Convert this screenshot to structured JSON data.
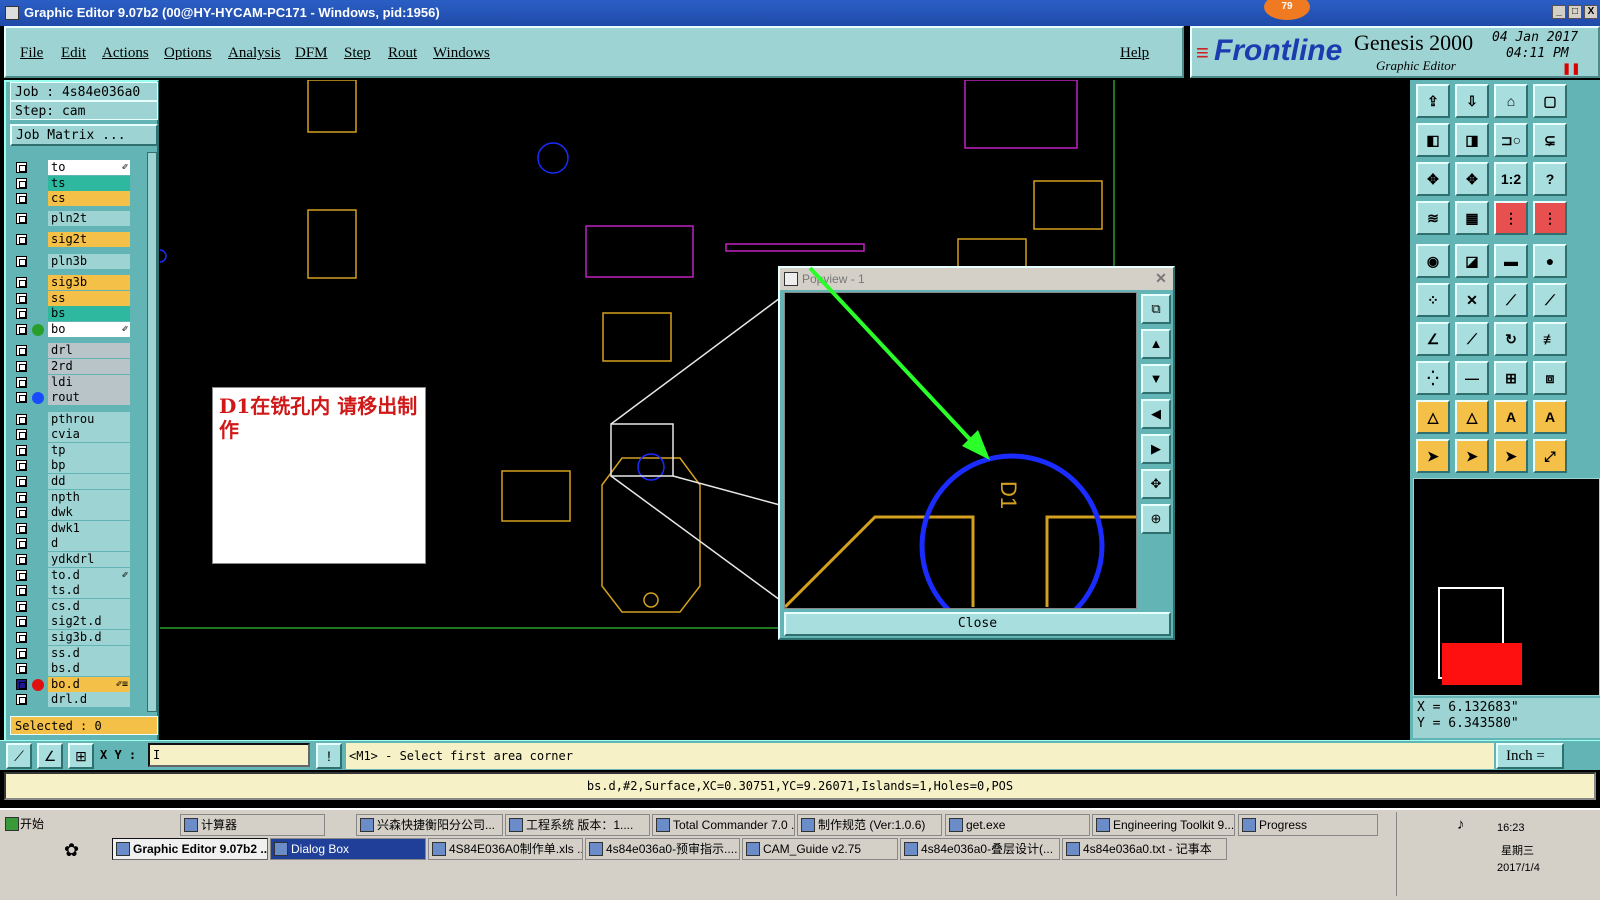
{
  "window": {
    "title": "Graphic Editor 9.07b2 (00@HY-HYCAM-PC171 - Windows, pid:1956)",
    "badge": "79",
    "min": "_",
    "max": "□",
    "close": "X"
  },
  "menu": {
    "file": "File",
    "edit": "Edit",
    "actions": "Actions",
    "options": "Options",
    "analysis": "Analysis",
    "dfm": "DFM",
    "step": "Step",
    "rout": "Rout",
    "windows": "Windows",
    "help": "Help"
  },
  "brand": {
    "logo": "Frontline",
    "product": "Genesis 2000",
    "subtitle": "Graphic Editor",
    "date": "04 Jan 2017",
    "time": "04:11 PM"
  },
  "job": {
    "job_line": "Job : 4s84e036a0",
    "step_line": "Step: cam",
    "matrix_button": "Job Matrix ...",
    "selected": "Selected : 0"
  },
  "layers": [
    {
      "name": "to",
      "color": "#ffffff",
      "mark": "✐"
    },
    {
      "name": "ts",
      "color": "#2fb8a0"
    },
    {
      "name": "cs",
      "color": "#f5c048"
    },
    {
      "name": "pln2t",
      "color": "#9ed3d3"
    },
    {
      "name": "sig2t",
      "color": "#f5c048"
    },
    {
      "name": "pln3b",
      "color": "#9ed3d3"
    },
    {
      "name": "sig3b",
      "color": "#f5c048"
    },
    {
      "name": "ss",
      "color": "#f5c048"
    },
    {
      "name": "bs",
      "color": "#2fb8a0"
    },
    {
      "name": "bo",
      "color": "#ffffff",
      "mark": "✐",
      "dot": "#2a9e2a"
    },
    {
      "name": "drl",
      "color": "#b8c4c8"
    },
    {
      "name": "2rd",
      "color": "#b8c4c8"
    },
    {
      "name": "ldi",
      "color": "#b8c4c8"
    },
    {
      "name": "rout",
      "color": "#b8c4c8",
      "dot": "#1a4cff"
    },
    {
      "name": "pthrou",
      "color": "#9ed3d3"
    },
    {
      "name": "cvia",
      "color": "#9ed3d3"
    },
    {
      "name": "tp",
      "color": "#9ed3d3"
    },
    {
      "name": "bp",
      "color": "#9ed3d3"
    },
    {
      "name": "dd",
      "color": "#9ed3d3"
    },
    {
      "name": "npth",
      "color": "#9ed3d3"
    },
    {
      "name": "dwk",
      "color": "#9ed3d3"
    },
    {
      "name": "dwk1",
      "color": "#9ed3d3"
    },
    {
      "name": "d",
      "color": "#9ed3d3"
    },
    {
      "name": "ydkdrl",
      "color": "#9ed3d3"
    },
    {
      "name": "to.d",
      "color": "#9ed3d3",
      "mark": "✐"
    },
    {
      "name": "ts.d",
      "color": "#9ed3d3"
    },
    {
      "name": "cs.d",
      "color": "#9ed3d3"
    },
    {
      "name": "sig2t.d",
      "color": "#9ed3d3"
    },
    {
      "name": "sig3b.d",
      "color": "#9ed3d3"
    },
    {
      "name": "ss.d",
      "color": "#9ed3d3"
    },
    {
      "name": "bs.d",
      "color": "#9ed3d3"
    },
    {
      "name": "bo.d",
      "color": "#f5c048",
      "mark": "✐≡",
      "dot": "#e01010",
      "checked": true
    },
    {
      "name": "drl.d",
      "color": "#9ed3d3"
    }
  ],
  "note": "D1在铣孔内 请移出制作",
  "popview": {
    "title": "Popview - 1",
    "close": "Close",
    "label": "D1"
  },
  "coords": {
    "x": "X = 6.132683\"",
    "y": "Y = 6.343580\""
  },
  "command": {
    "xy_label": "X Y :",
    "xy_value": "I",
    "prompt": "<M1> - Select first area corner",
    "unit": "Inch ="
  },
  "status": "bs.d,#2,Surface,XC=0.30751,YC=9.26071,Islands=1,Holes=0,POS",
  "taskbar": {
    "start": "开始",
    "row1": [
      "计算器",
      "兴森快捷衡阳分公司...",
      "工程系统  版本：1....",
      "Total Commander 7.0 ...",
      "制作规范 (Ver:1.0.6)",
      "get.exe",
      "Engineering Toolkit 9....",
      "Progress"
    ],
    "row2": [
      "Graphic Editor 9.07b2 ...",
      "Dialog Box",
      "4S84E036A0制作单.xls ...",
      "4s84e036a0-预审指示....",
      "CAM_Guide v2.75",
      "4s84e036a0-叠层设计(...",
      "4s84e036a0.txt - 记事本"
    ],
    "clock": "16:23",
    "weekday": "星期三",
    "date": "2017/1/4"
  },
  "colors": {
    "panel": "#63b5b5",
    "panel_light": "#9ed3d3",
    "route": "#d4a020",
    "hole": "#1a2cff",
    "arrow": "#2aff2a"
  }
}
